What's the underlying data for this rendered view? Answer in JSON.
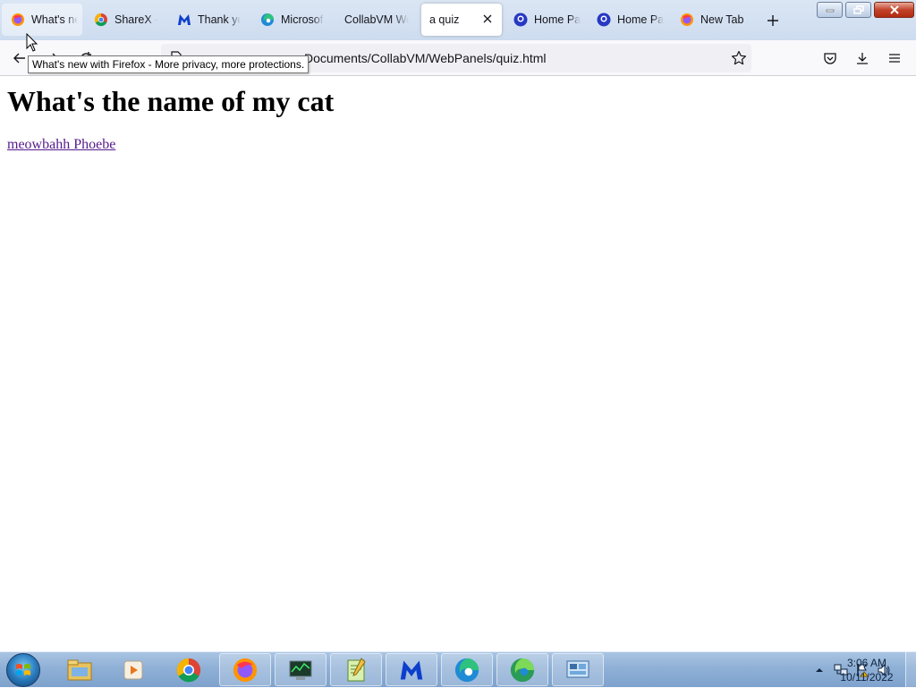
{
  "browser": {
    "tabs": [
      {
        "label": "What's new with Firefox",
        "icon": "firefox-icon"
      },
      {
        "label": "ShareX - The best free",
        "icon": "chrome-icon"
      },
      {
        "label": "Thank you for",
        "icon": "malwarebytes-icon"
      },
      {
        "label": "Microsoft Edge",
        "icon": "edge-icon"
      },
      {
        "label": "CollabVM WebPanels",
        "icon": "blank-page-icon"
      },
      {
        "label": "a quiz",
        "icon": "none"
      },
      {
        "label": "Home Page",
        "icon": "pbs-kids-icon"
      },
      {
        "label": "Home Page",
        "icon": "pbs-kids-icon"
      },
      {
        "label": "New Tab",
        "icon": "firefox-icon"
      }
    ],
    "url": "Documents/CollabVM/WebPanels/quiz.html",
    "tooltip": "What's new with Firefox - More privacy, more protections."
  },
  "page": {
    "heading": "What's the name of my cat",
    "link": "meowbahh Phoebe"
  },
  "taskbar": {
    "clock_time": "3:06 AM",
    "clock_date": "10/11/2022"
  },
  "colors": {
    "visited_link": "#551a8b",
    "close_button": "#c2432a"
  }
}
